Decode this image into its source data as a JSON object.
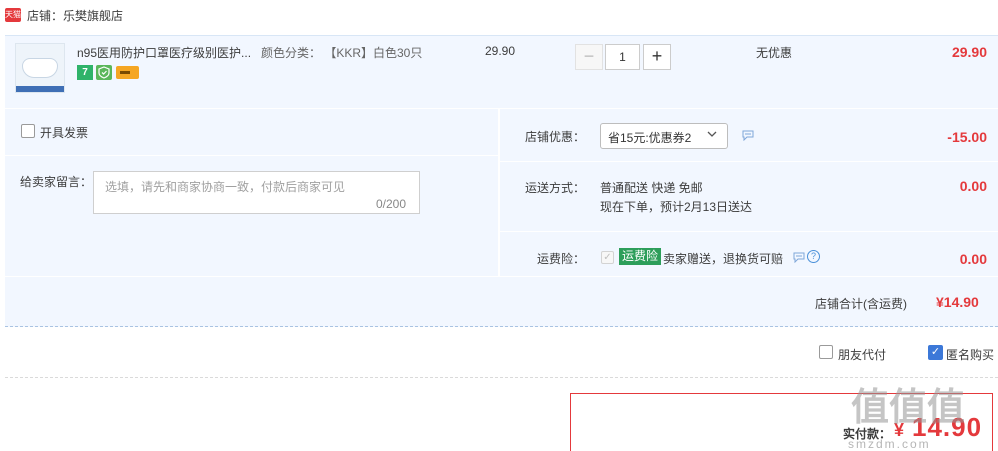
{
  "shop": {
    "badge": "天猫",
    "name": "店铺：乐樊旗舰店"
  },
  "item": {
    "title": "n95医用防护口罩医疗级别医护...",
    "sku": "颜色分类： 【KKR】白色30只",
    "unit_price": "29.90",
    "quantity": "1",
    "minus_label": "−",
    "plus_label": "+",
    "seven_day_icon": "7",
    "discount_text": "无优惠",
    "total": "29.90",
    "icons": [
      "seven-day-return-icon",
      "shield-guarantee-icon",
      "card-payment-icon"
    ]
  },
  "invoice": {
    "label": "开具发票"
  },
  "message": {
    "label": "给卖家留言：",
    "placeholder": "选填，请先和商家协商一致，付款后商家可见",
    "counter": "0/200"
  },
  "coupon": {
    "label": "店铺优惠：",
    "selected": "省15元:优惠券2",
    "amount": "-15.00"
  },
  "shipping": {
    "label": "运送方式：",
    "method": "普通配送 快递 免邮",
    "eta": "现在下单，预计2月13日送达",
    "fee": "0.00"
  },
  "insurance": {
    "label": "运费险：",
    "badge": "运费险",
    "text": "卖家赠送，退换货可赔",
    "fee": "0.00"
  },
  "subtotal": {
    "label": "店铺合计(含运费)",
    "amount": "¥14.90"
  },
  "options": {
    "friend_pay": "朋友代付",
    "anonymous": "匿名购买"
  },
  "payment": {
    "label": "实付款：",
    "currency": "¥",
    "amount": "14.90"
  },
  "watermark": {
    "main": "值值值",
    "sub": "smzdm.com"
  },
  "colors": {
    "price_red": "#e4393c",
    "row_bg": "#f2f7ff",
    "insurance_green": "#2d9e5a",
    "checkbox_blue": "#3c78d8"
  }
}
